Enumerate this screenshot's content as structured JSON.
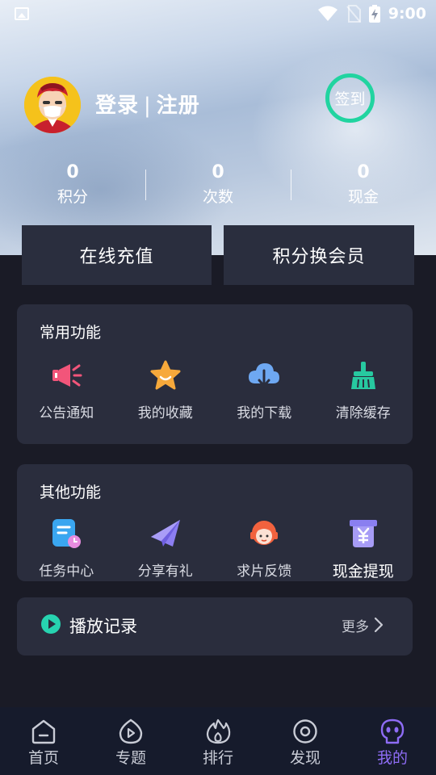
{
  "status_bar": {
    "time": "9:00"
  },
  "profile": {
    "login_label": "登录",
    "separator": "|",
    "register_label": "注册",
    "signin_label": "签到"
  },
  "stats": [
    {
      "value": "0",
      "label": "积分"
    },
    {
      "value": "0",
      "label": "次数"
    },
    {
      "value": "0",
      "label": "现金"
    }
  ],
  "actions": {
    "recharge_label": "在线充值",
    "exchange_label": "积分换会员"
  },
  "common_functions": {
    "title": "常用功能",
    "items": [
      {
        "label": "公告通知",
        "icon": "megaphone-icon",
        "color": "#f2557a"
      },
      {
        "label": "我的收藏",
        "icon": "star-icon",
        "color": "#f7a93b"
      },
      {
        "label": "我的下载",
        "icon": "cloud-download-icon",
        "color": "#6ea8f2"
      },
      {
        "label": "清除缓存",
        "icon": "broom-icon",
        "color": "#27c9a0"
      }
    ]
  },
  "other_functions": {
    "title": "其他功能",
    "items": [
      {
        "label": "任务中心",
        "icon": "task-icon",
        "color": "#3aa6f0"
      },
      {
        "label": "分享有礼",
        "icon": "paper-plane-icon",
        "color": "#8c7ef2"
      },
      {
        "label": "求片反馈",
        "icon": "support-agent-icon",
        "color": "#f2623e"
      },
      {
        "label": "现金提现",
        "icon": "cash-withdraw-icon",
        "color": "#8a7ff0"
      }
    ]
  },
  "history": {
    "title": "播放记录",
    "more_label": "更多"
  },
  "tabbar": {
    "items": [
      {
        "label": "首页",
        "icon": "home-icon"
      },
      {
        "label": "专题",
        "icon": "play-drop-icon"
      },
      {
        "label": "排行",
        "icon": "flame-icon"
      },
      {
        "label": "发现",
        "icon": "discover-icon"
      },
      {
        "label": "我的",
        "icon": "profile-face-icon",
        "active": true
      }
    ]
  },
  "colors": {
    "accent": "#8e6cf5",
    "signin_ring": "#21d4a0",
    "card_bg": "#2a2d3d",
    "page_bg": "#1a1b26",
    "tabbar_bg": "#161b2c"
  }
}
